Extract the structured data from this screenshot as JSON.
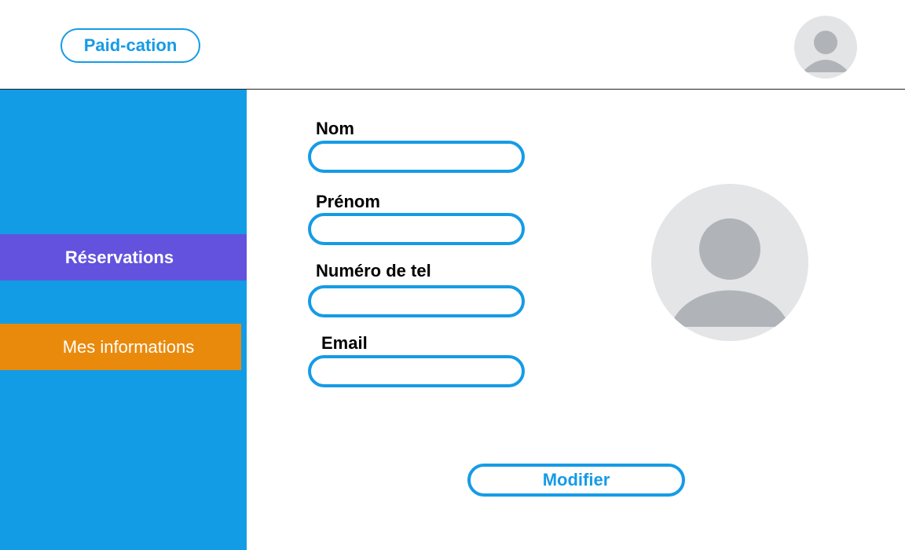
{
  "header": {
    "logo_label": "Paid-cation",
    "avatar_icon": "user-avatar-icon"
  },
  "sidebar": {
    "items": [
      {
        "label": "Réservations",
        "color": "#6352dd",
        "active": false
      },
      {
        "label": "Mes informations",
        "color": "#ea8a0c",
        "active": true
      }
    ],
    "background": "#129ce5"
  },
  "form": {
    "fields": [
      {
        "label": "Nom",
        "value": "",
        "placeholder": ""
      },
      {
        "label": "Prénom",
        "value": "",
        "placeholder": ""
      },
      {
        "label": "Numéro de tel",
        "value": "",
        "placeholder": ""
      },
      {
        "label": "Email",
        "value": "",
        "placeholder": ""
      }
    ],
    "submit_label": "Modifier"
  },
  "profile": {
    "avatar_icon": "user-avatar-icon"
  },
  "colors": {
    "accent": "#169be6",
    "avatar_bg": "#e4e5e7",
    "avatar_fg": "#b0b4b8"
  }
}
